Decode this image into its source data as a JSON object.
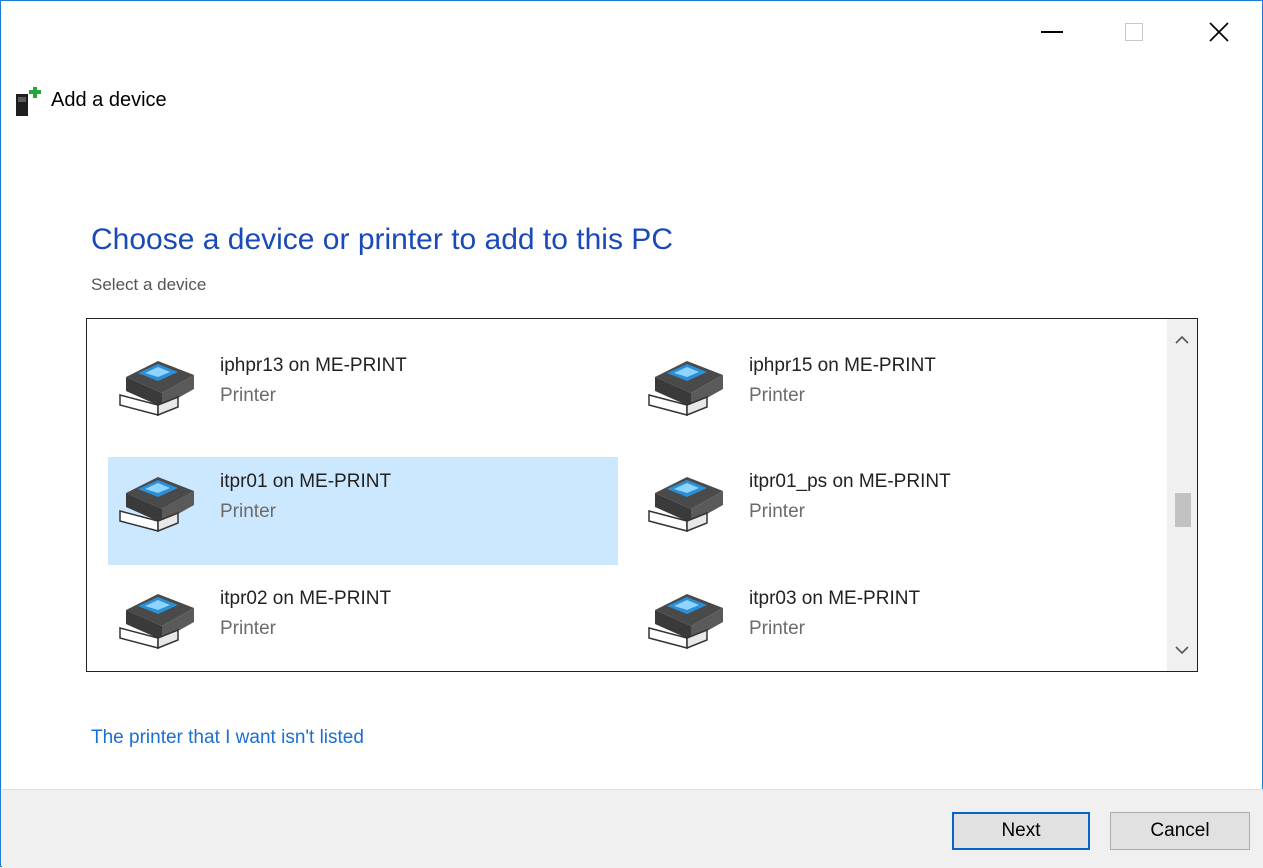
{
  "window": {
    "title": "Add a device"
  },
  "header": {
    "heading": "Choose a device or printer to add to this PC",
    "subheading": "Select a device"
  },
  "devices": [
    {
      "name": "",
      "type": "Printer",
      "selected": false
    },
    {
      "name": "",
      "type": "Printer",
      "selected": false
    },
    {
      "name": "iphpr13 on ME-PRINT",
      "type": "Printer",
      "selected": false
    },
    {
      "name": "iphpr15 on ME-PRINT",
      "type": "Printer",
      "selected": false
    },
    {
      "name": "itpr01 on ME-PRINT",
      "type": "Printer",
      "selected": true
    },
    {
      "name": "itpr01_ps on ME-PRINT",
      "type": "Printer",
      "selected": false
    },
    {
      "name": "itpr02 on ME-PRINT",
      "type": "Printer",
      "selected": false
    },
    {
      "name": "itpr03 on ME-PRINT",
      "type": "Printer",
      "selected": false
    }
  ],
  "links": {
    "not_listed": "The printer that I want isn't listed"
  },
  "footer": {
    "next_label": "Next",
    "cancel_label": "Cancel"
  },
  "colors": {
    "heading": "#1a4ab8",
    "link": "#1a6fd6",
    "selection": "#cce8ff",
    "window_border": "#1a7fd4"
  },
  "icons": {
    "app": "add-device-icon",
    "device": "printer-icon"
  }
}
